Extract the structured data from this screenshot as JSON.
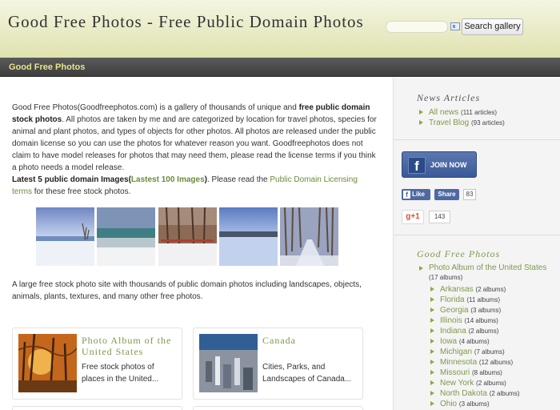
{
  "header": {
    "title": "Good Free Photos - Free Public Domain Photos",
    "search_placeholder": "",
    "search_button": "Search gallery"
  },
  "nav": {
    "brand": "Good Free Photos"
  },
  "main": {
    "intro_p1_a": "Good Free Photos(Goodfreephotos.com) is a gallery of thousands of unique and ",
    "intro_p1_bold": "free public domain stock photos",
    "intro_p1_b": ". All photos are taken by me and are categorized by location for travel photos, species for animal and plant photos, and types of objects for other photos. All photos are released under the public domain license so you can use the photos for whatever reason you want. Goodfreephotos does not claim to have model releases for photos that may need them, please read the license terms if you think a photo needs a model release.",
    "latest_bold": "Latest 5 public domain Images(",
    "latest_link": "Lastest 100 Images",
    "latest_close": ")",
    "latest_text": ". Please read the ",
    "license_link": "Public Domain Licensing terms",
    "latest_tail": " for these free stock photos.",
    "tagline": "A large free stock photo site with thousands of public domain photos including landscapes, objects, animals, plants, textures, and many other free photos.",
    "albums": [
      {
        "title": "Photo Album of the United States",
        "desc": "Free stock photos of places in the United..."
      },
      {
        "title": "Canada",
        "desc": "Cities, Parks, and Landscapes of Canada..."
      }
    ]
  },
  "sidebar": {
    "news_heading": "News Articles",
    "news_items": [
      {
        "label": "All news",
        "count": "(111 articles)"
      },
      {
        "label": "Travel Blog",
        "count": "(93 articles)"
      }
    ],
    "join_label": "JOIN NOW",
    "fb_letter": "f",
    "like_label": "Like",
    "share_label": "Share",
    "share_count": "83",
    "gplus_label": "g+1",
    "gplus_count": "143",
    "photos_heading": "Good Free Photos",
    "album_link": {
      "label": "Photo Album of the United States",
      "count": "(17 albums)"
    },
    "states": [
      {
        "label": "Arkansas",
        "count": "(2 albums)"
      },
      {
        "label": "Florida",
        "count": "(11 albums)"
      },
      {
        "label": "Georgia",
        "count": "(3 albums)"
      },
      {
        "label": "Illinois",
        "count": "(14 albums)"
      },
      {
        "label": "Indiana",
        "count": "(2 albums)"
      },
      {
        "label": "Iowa",
        "count": "(4 albums)"
      },
      {
        "label": "Michigan",
        "count": "(7 albums)"
      },
      {
        "label": "Minnesota",
        "count": "(12 albums)"
      },
      {
        "label": "Missouri",
        "count": "(8 albums)"
      },
      {
        "label": "New York",
        "count": "(2 albums)"
      },
      {
        "label": "North Dakota",
        "count": "(2 albums)"
      },
      {
        "label": "Ohio",
        "count": "(3 albums)"
      }
    ]
  },
  "colors": {
    "accent_green": "#7c9a4a",
    "nav_bg": "#4a4a4a",
    "nav_text": "#e8e48a",
    "facebook_blue": "#3b5998"
  }
}
